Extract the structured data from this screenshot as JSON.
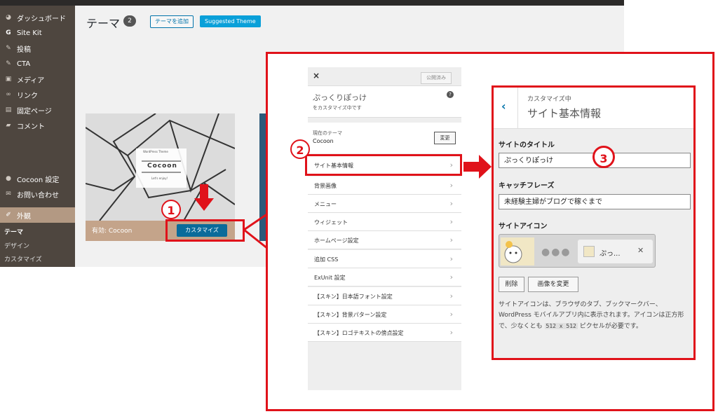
{
  "admin": {
    "menu": [
      {
        "label": "ダッシュボード",
        "icon": "dashboard-icon"
      },
      {
        "label": "Site Kit",
        "icon": "google-g-icon"
      },
      {
        "label": "投稿",
        "icon": "pin-icon"
      },
      {
        "label": "CTA",
        "icon": "pin-icon"
      },
      {
        "label": "メディア",
        "icon": "media-icon"
      },
      {
        "label": "リンク",
        "icon": "link-icon"
      },
      {
        "label": "固定ページ",
        "icon": "page-icon"
      },
      {
        "label": "コメント",
        "icon": "comment-icon"
      },
      {
        "label": "Cocoon 設定",
        "icon": "cocoon-icon"
      },
      {
        "label": "お問い合わせ",
        "icon": "mail-icon"
      },
      {
        "label": "外観",
        "icon": "brush-icon"
      }
    ],
    "submenu": [
      "テーマ",
      "デザイン",
      "カスタマイズ"
    ],
    "page_title": "テーマ",
    "theme_count": "2",
    "add_button": "テーマを追加",
    "suggested_button": "Suggested Theme",
    "theme_card": {
      "shot_title": "WordPress Theme",
      "shot_name": "Cocoon",
      "shot_tagline": "Let's enjoy!",
      "active_label": "有効: Cocoon",
      "customize_button": "カスタマイズ"
    }
  },
  "customizer": {
    "close": "×",
    "published": "公開済み",
    "site_name": "ぷっくりぽっけ",
    "subtitle": "をカスタマイズ中です",
    "help": "?",
    "current_theme_label": "現在のテーマ",
    "current_theme": "Cocoon",
    "change_button": "変更",
    "sections": [
      "サイト基本情報",
      "背景画像",
      "メニュー",
      "ウィジェット",
      "ホームページ設定",
      "追加 CSS",
      "ExUnit 設定",
      "【スキン】日本語フォント設定",
      "【スキン】背景パターン設定",
      "【スキン】ロゴテキストの傍点設定"
    ]
  },
  "settings": {
    "breadcrumb": "カスタマイズ中",
    "heading": "サイト基本情報",
    "title_label": "サイトのタイトル",
    "title_value": "ぷっくりぽっけ",
    "tagline_label": "キャッチフレーズ",
    "tagline_value": "未経験主婦がブログで稼ぐまで",
    "icon_label": "サイトアイコン",
    "icon_tab_text": "ぷっ...",
    "remove_button": "削除",
    "change_image_button": "画像を変更",
    "help_text_1": "サイトアイコンは、ブラウザのタブ、ブックマークバー、WordPress モバイルアプリ内に表示されます。アイコンは正方形で、少なくとも ",
    "help_code": "512 x 512",
    "help_text_2": " ピクセルが必要です。"
  },
  "annotations": [
    "1",
    "2",
    "3"
  ],
  "colors": {
    "accent_red": "#e0121a",
    "wp_blue": "#0073aa",
    "sidebar": "#4e463f"
  }
}
